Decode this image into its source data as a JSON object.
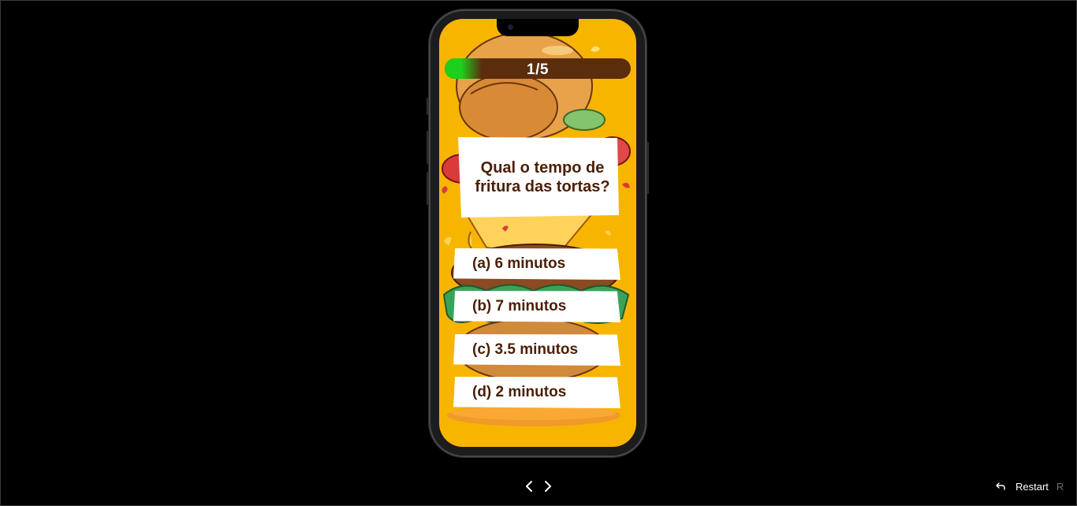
{
  "quiz": {
    "progress_label": "1/5",
    "progress_fraction": 0.2,
    "question": "Qual o tempo de fritura das tortas?",
    "options": [
      {
        "label": "(a) 6 minutos"
      },
      {
        "label": "(b) 7 minutos"
      },
      {
        "label": "(c) 3.5 minutos"
      },
      {
        "label": "(d) 2 minutos"
      }
    ]
  },
  "controls": {
    "prev_icon": "chevron-left-icon",
    "next_icon": "chevron-right-icon",
    "restart_icon": "undo-icon",
    "restart_label": "Restart",
    "restart_shortcut": "R"
  },
  "colors": {
    "screen_background": "#f7b500",
    "progress_track": "#5c2d0d",
    "progress_fill": "#1bd11b",
    "text_brown": "#4a1f05",
    "page_background": "#000000"
  }
}
